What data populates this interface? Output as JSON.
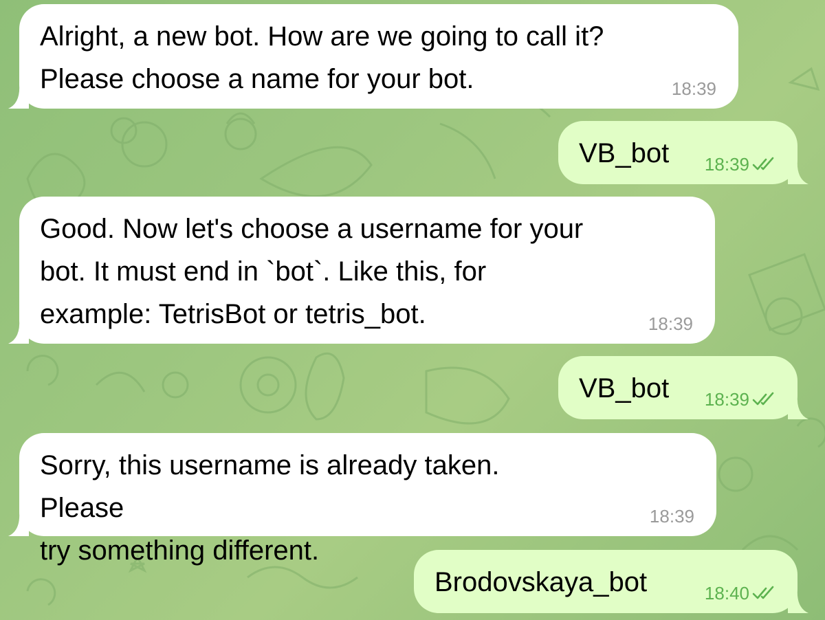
{
  "colors": {
    "incoming_bubble": "#ffffff",
    "outgoing_bubble": "#e1fec6",
    "incoming_time": "#9a9a9a",
    "outgoing_time": "#5cb24f",
    "wallpaper": "#9cc67f"
  },
  "messages": [
    {
      "direction": "incoming",
      "text": "Alright, a new bot. How are we going to call it?\nPlease choose a name for your bot.",
      "time": "18:39"
    },
    {
      "direction": "outgoing",
      "text": "VB_bot",
      "time": "18:39",
      "status_icon": "double-check-icon"
    },
    {
      "direction": "incoming",
      "text": "Good. Now let's choose a username for your\nbot. It must end in `bot`. Like this, for\nexample: TetrisBot or tetris_bot.",
      "time": "18:39"
    },
    {
      "direction": "outgoing",
      "text": "VB_bot",
      "time": "18:39",
      "status_icon": "double-check-icon"
    },
    {
      "direction": "incoming",
      "text": "Sorry, this username is already taken. Please\ntry something different.",
      "time": "18:39"
    },
    {
      "direction": "outgoing",
      "text": "Brodovskaya_bot",
      "time": "18:40",
      "status_icon": "double-check-icon"
    }
  ]
}
